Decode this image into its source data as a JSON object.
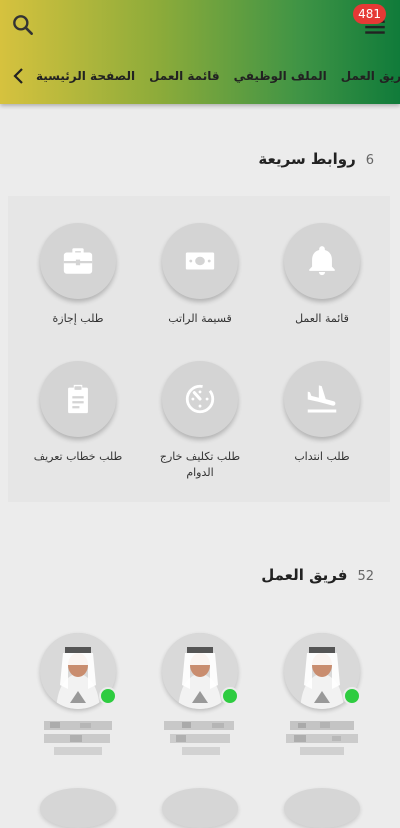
{
  "header": {
    "notification_count": "481",
    "tabs": [
      "الصفحة الرئيسية",
      "قائمة العمل",
      "الملف الوظيفي",
      "فريق العمل"
    ]
  },
  "quick_links": {
    "title": "روابط سريعة",
    "count": "6",
    "items": [
      {
        "label": "قائمة العمل",
        "icon": "bell-icon"
      },
      {
        "label": "قسيمة الراتب",
        "icon": "money-icon"
      },
      {
        "label": "طلب إجازة",
        "icon": "briefcase-icon"
      },
      {
        "label": "طلب انتداب",
        "icon": "plane-icon"
      },
      {
        "label": "طلب تكليف خارج الدوام",
        "icon": "timer-icon"
      },
      {
        "label": "طلب خطاب تعريف",
        "icon": "clipboard-icon"
      }
    ]
  },
  "team": {
    "title": "فريق العمل",
    "count": "52"
  },
  "colors": {
    "header_start": "#d6c23e",
    "header_end": "#107b3a",
    "badge": "#e53935",
    "online": "#2ecc40"
  }
}
